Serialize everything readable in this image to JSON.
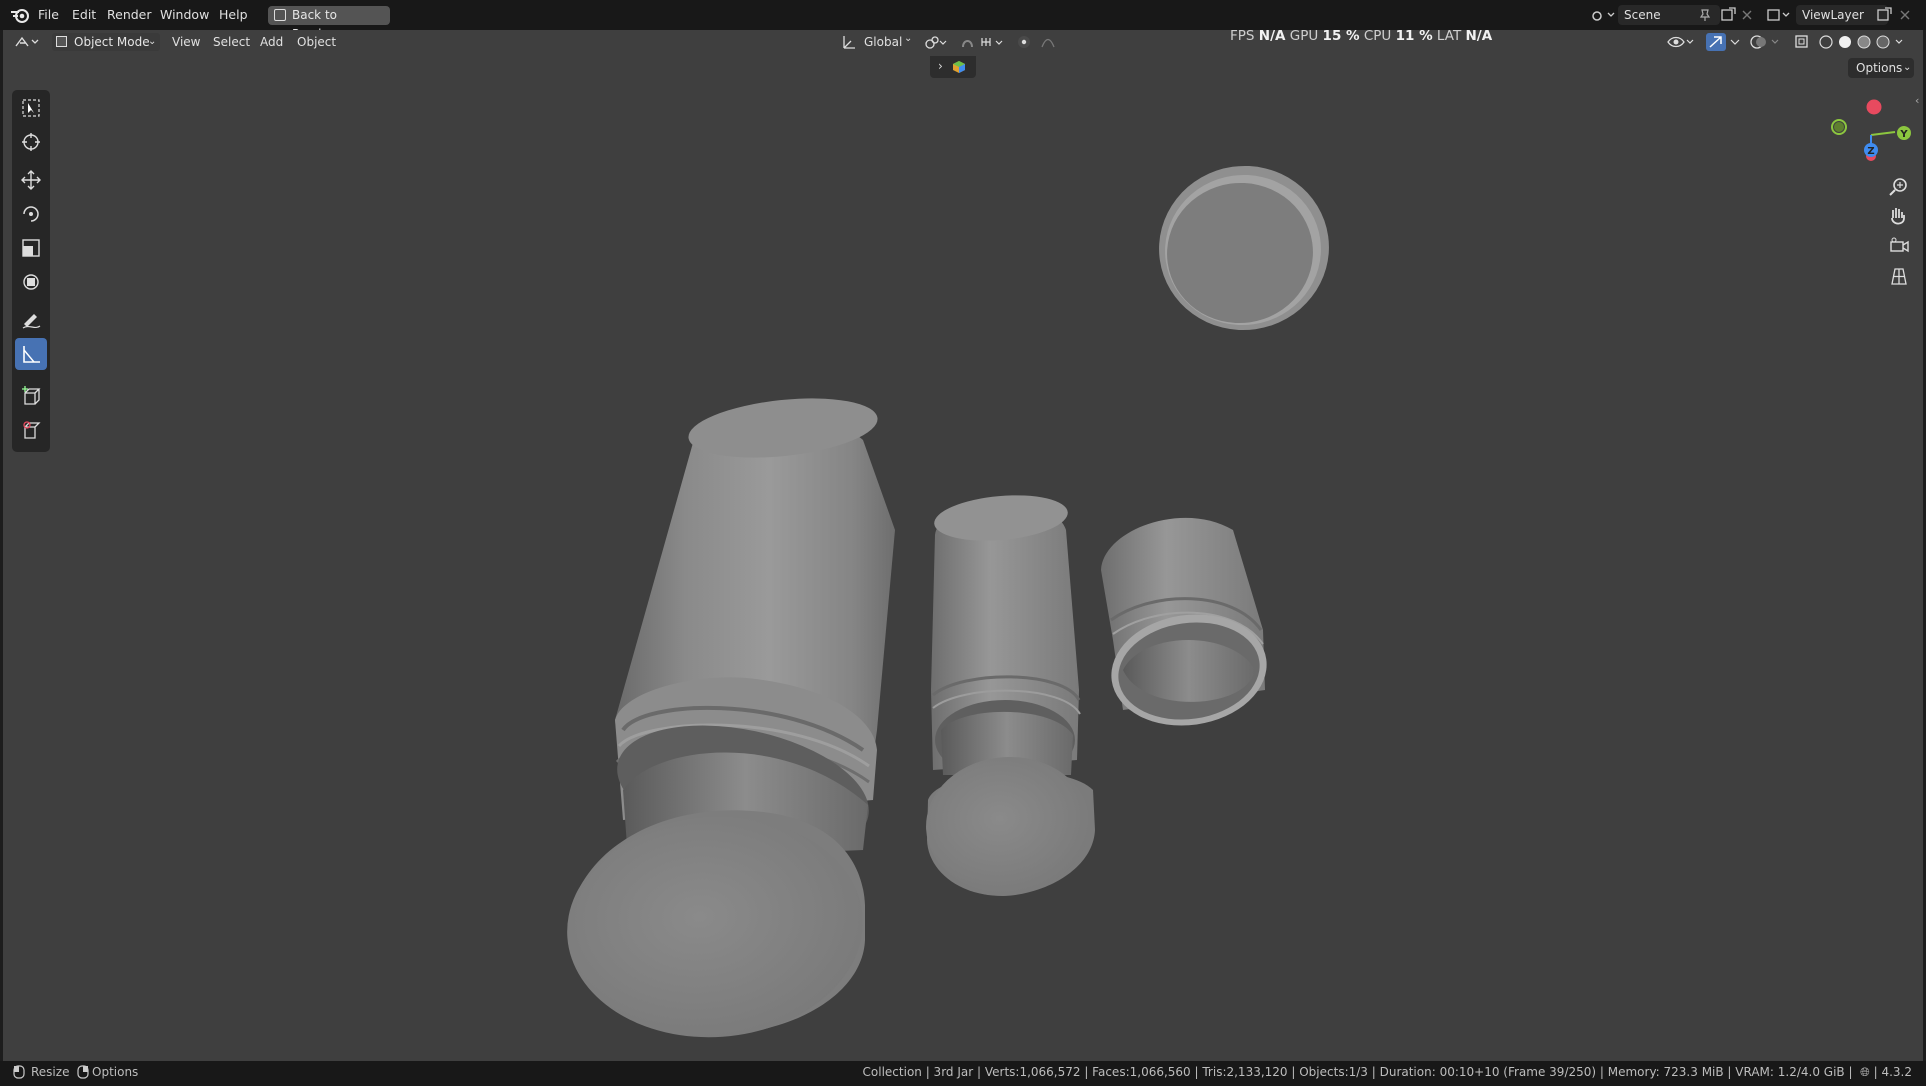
{
  "menu": {
    "file": "File",
    "edit": "Edit",
    "render": "Render",
    "window": "Window",
    "help": "Help",
    "back": "Back to Previous"
  },
  "scene": {
    "label": "Scene",
    "view_layer": "ViewLayer"
  },
  "header": {
    "mode": "Object Mode",
    "view": "View",
    "select": "Select",
    "add": "Add",
    "object": "Object",
    "transform_orientation": "Global",
    "options": "Options"
  },
  "stats": {
    "fps_label": "FPS",
    "fps_value": "N/A",
    "gpu_label": "GPU",
    "gpu_value": "15 %",
    "cpu_label": "CPU",
    "cpu_value": "11 %",
    "lat_label": "LAT",
    "lat_value": "N/A"
  },
  "gizmo": {
    "y": "Y",
    "z": "Z"
  },
  "status": {
    "resize": "Resize",
    "options": "Options",
    "info": "Collection | 3rd Jar | Verts:1,066,572 | Faces:1,066,560 | Tris:2,133,120 | Objects:1/3 | Duration: 00:10+10 (Frame 39/250) | Memory: 723.3 MiB | VRAM: 1.2/4.0 GiB |",
    "version": "| 4.3.2"
  },
  "colors": {
    "accent": "#4772b3",
    "x_axis": "#e84a5f",
    "y_axis": "#8cc63f",
    "z_axis": "#3f8cf0"
  }
}
